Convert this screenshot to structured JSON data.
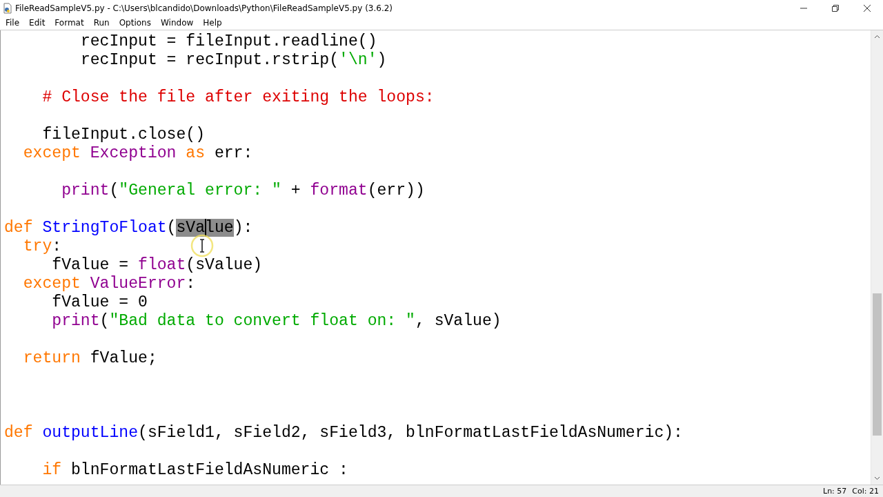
{
  "window": {
    "title": "FileReadSampleV5.py - C:\\Users\\blcandido\\Downloads\\Python\\FileReadSampleV5.py (3.6.2)"
  },
  "menu": [
    "File",
    "Edit",
    "Format",
    "Run",
    "Options",
    "Window",
    "Help"
  ],
  "code": [
    {
      "kind": "code",
      "segments": [
        {
          "kind": "plain",
          "text": "        recInput = fileInput.readline()"
        }
      ]
    },
    {
      "kind": "code",
      "segments": [
        {
          "kind": "plain",
          "text": "        recInput = recInput.rstrip("
        },
        {
          "kind": "string",
          "text": "'\\n'"
        },
        {
          "kind": "plain",
          "text": ")"
        }
      ]
    },
    {
      "kind": "blank"
    },
    {
      "kind": "code",
      "segments": [
        {
          "kind": "comment",
          "text": "    # Close the file after exiting the loops:"
        }
      ]
    },
    {
      "kind": "blank"
    },
    {
      "kind": "code",
      "segments": [
        {
          "kind": "plain",
          "text": "    fileInput.close()"
        }
      ]
    },
    {
      "kind": "code",
      "segments": [
        {
          "kind": "keyword",
          "text": "  except"
        },
        {
          "kind": "builtin",
          "text": " Exception"
        },
        {
          "kind": "keyword",
          "text": " as"
        },
        {
          "kind": "plain",
          "text": " err:"
        }
      ]
    },
    {
      "kind": "blank"
    },
    {
      "kind": "code",
      "segments": [
        {
          "kind": "builtin",
          "text": "      print"
        },
        {
          "kind": "plain",
          "text": "("
        },
        {
          "kind": "string",
          "text": "\"General error: \""
        },
        {
          "kind": "plain",
          "text": " + "
        },
        {
          "kind": "builtin",
          "text": "format"
        },
        {
          "kind": "plain",
          "text": "(err))"
        }
      ]
    },
    {
      "kind": "blank"
    },
    {
      "kind": "code",
      "segments": [
        {
          "kind": "keyword",
          "text": "def"
        },
        {
          "kind": "definition",
          "text": " StringToFloat"
        },
        {
          "kind": "plain",
          "text": "("
        },
        {
          "kind": "selected",
          "text": "sVa"
        },
        {
          "kind": "selected",
          "text": "lue",
          "caret": true
        },
        {
          "kind": "plain",
          "text": "):"
        }
      ]
    },
    {
      "kind": "code",
      "segments": [
        {
          "kind": "keyword",
          "text": "  try"
        },
        {
          "kind": "plain",
          "text": ":"
        }
      ]
    },
    {
      "kind": "code",
      "segments": [
        {
          "kind": "plain",
          "text": "     fValue = "
        },
        {
          "kind": "builtin",
          "text": "float"
        },
        {
          "kind": "plain",
          "text": "(sValue)"
        }
      ]
    },
    {
      "kind": "code",
      "segments": [
        {
          "kind": "keyword",
          "text": "  except"
        },
        {
          "kind": "builtin",
          "text": " ValueError"
        },
        {
          "kind": "plain",
          "text": ":"
        }
      ]
    },
    {
      "kind": "code",
      "segments": [
        {
          "kind": "plain",
          "text": "     fValue = 0"
        }
      ]
    },
    {
      "kind": "code",
      "segments": [
        {
          "kind": "builtin",
          "text": "     print"
        },
        {
          "kind": "plain",
          "text": "("
        },
        {
          "kind": "string",
          "text": "\"Bad data to convert float on: \""
        },
        {
          "kind": "plain",
          "text": ", sValue)"
        }
      ]
    },
    {
      "kind": "blank"
    },
    {
      "kind": "code",
      "segments": [
        {
          "kind": "keyword",
          "text": "  return"
        },
        {
          "kind": "plain",
          "text": " fValue;"
        }
      ]
    },
    {
      "kind": "blank"
    },
    {
      "kind": "blank"
    },
    {
      "kind": "blank"
    },
    {
      "kind": "code",
      "segments": [
        {
          "kind": "keyword",
          "text": "def"
        },
        {
          "kind": "definition",
          "text": " outputLine"
        },
        {
          "kind": "plain",
          "text": "(sField1, sField2, sField3, blnFormatLastFieldAsNumeric):"
        }
      ]
    },
    {
      "kind": "blank"
    },
    {
      "kind": "code",
      "segments": [
        {
          "kind": "keyword",
          "text": "    if"
        },
        {
          "kind": "plain",
          "text": " blnFormatLastFieldAsNumeric :"
        }
      ]
    }
  ],
  "status_bar": {
    "line": "Ln: 57",
    "column": "Col: 21"
  }
}
